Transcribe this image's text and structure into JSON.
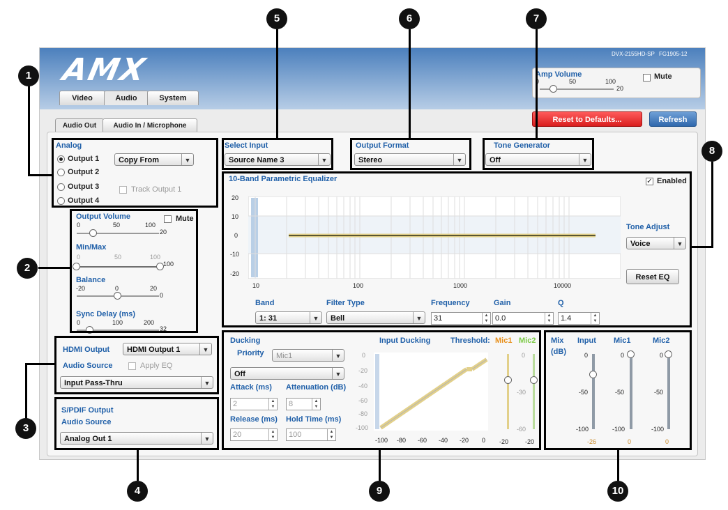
{
  "header": {
    "model": "DVX-2155HD-SP",
    "firmware": "FG1905-12",
    "amp_volume": {
      "label": "Amp Volume",
      "tick0": "0",
      "tick50": "50",
      "tick100": "100",
      "value": "20",
      "mute_label": "Mute"
    },
    "main_tabs": [
      "Video",
      "Audio",
      "System"
    ],
    "reset_label": "Reset to Defaults...",
    "refresh_label": "Refresh"
  },
  "sub_tabs": [
    "Audio Out",
    "Audio In / Microphone"
  ],
  "analog": {
    "title": "Analog",
    "outputs": [
      "Output 1",
      "Output 2",
      "Output 3",
      "Output 4"
    ],
    "selected_output": "Output 1",
    "copy_from": "Copy From",
    "track_label": "Track Output 1"
  },
  "volume": {
    "output_volume_label": "Output Volume",
    "mute_label": "Mute",
    "ov_ticks": [
      "0",
      "50",
      "100"
    ],
    "ov_value": "20",
    "minmax_label": "Min/Max",
    "mm_ticks": [
      "0",
      "50",
      "100"
    ],
    "mm_value": "100",
    "balance_label": "Balance",
    "bal_ticks": [
      "-20",
      "0",
      "20"
    ],
    "bal_value": "0",
    "sync_label": "Sync Delay (ms)",
    "sync_ticks": [
      "0",
      "100",
      "200"
    ],
    "sync_value": "32"
  },
  "hdmi": {
    "output_label": "HDMI Output",
    "output_value": "HDMI Output 1",
    "source_label": "Audio Source",
    "apply_eq": "Apply EQ",
    "source_value": "Input Pass-Thru"
  },
  "spdif": {
    "title": "S/PDIF Output",
    "source_label": "Audio Source",
    "source_value": "Analog Out 1"
  },
  "select_input": {
    "label": "Select Input",
    "value": "Source Name 3"
  },
  "output_format": {
    "label": "Output Format",
    "value": "Stereo"
  },
  "tone_generator": {
    "label": "Tone Generator",
    "value": "Off"
  },
  "eq": {
    "title": "10-Band Parametric Equalizer",
    "enabled_label": "Enabled",
    "y_ticks": [
      "20",
      "10",
      "0",
      "-10",
      "-20"
    ],
    "x_ticks": [
      "10",
      "100",
      "1000",
      "10000"
    ],
    "tone_adjust_label": "Tone Adjust",
    "tone_adjust_value": "Voice",
    "reset_eq": "Reset EQ",
    "band_label": "Band",
    "band_value": "1: 31",
    "filter_label": "Filter Type",
    "filter_value": "Bell",
    "frequency_label": "Frequency",
    "frequency_value": "31",
    "gain_label": "Gain",
    "gain_value": "0.0",
    "q_label": "Q",
    "q_value": "1.4"
  },
  "ducking": {
    "title": "Ducking",
    "priority_label": "Priority",
    "priority_value": "Mic1",
    "mode_value": "Off",
    "attack_label": "Attack (ms)",
    "attack_value": "2",
    "atten_label": "Attenuation (dB)",
    "atten_value": "8",
    "release_label": "Release (ms)",
    "release_value": "20",
    "hold_label": "Hold Time (ms)",
    "hold_value": "100",
    "graph_title": "Input Ducking",
    "threshold_label": "Threshold:",
    "mic1_label": "Mic1",
    "mic2_label": "Mic2",
    "y_ticks": [
      "0",
      "-20",
      "-40",
      "-60",
      "-80",
      "-100"
    ],
    "x_ticks": [
      "-100",
      "-80",
      "-60",
      "-40",
      "-20",
      "0"
    ],
    "slider_ticks": [
      "0",
      "-30",
      "-60"
    ],
    "mic1_value": "-20",
    "mic2_value": "-20",
    "colors": {
      "mic1": "#e8901c",
      "mic2": "#7ac943"
    }
  },
  "mix": {
    "title": "Mix",
    "unit": "(dB)",
    "columns": [
      "Input",
      "Mic1",
      "Mic2"
    ],
    "ticks": [
      "0",
      "-50",
      "-100"
    ],
    "values": [
      "-26",
      "0",
      "0"
    ]
  },
  "callouts": [
    "1",
    "2",
    "3",
    "4",
    "5",
    "6",
    "7",
    "8",
    "9",
    "10"
  ]
}
